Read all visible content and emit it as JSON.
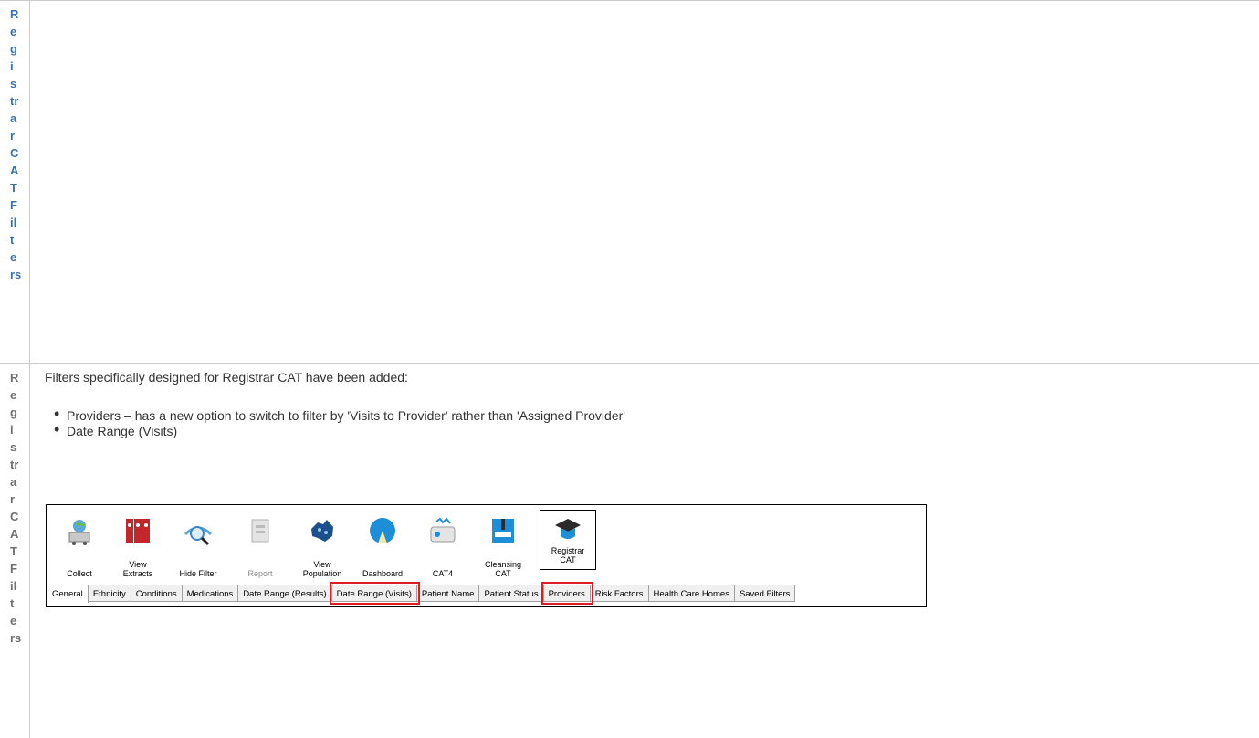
{
  "rows": [
    {
      "label_chars": [
        "R",
        "e",
        "g",
        "i",
        "s",
        "tr",
        "a",
        "r",
        "C",
        "A",
        "T",
        "F",
        "il",
        "t",
        "e",
        "rs"
      ]
    },
    {
      "label_chars": [
        "R",
        "e",
        "g",
        "i",
        "s",
        "tr",
        "a",
        "r",
        "C",
        "A",
        "T",
        "F",
        "il",
        "t",
        "e",
        "rs"
      ]
    }
  ],
  "content": {
    "intro": "Filters specifically designed for Registrar CAT have been added:",
    "bullets": [
      "Providers – has a new option to switch to filter by 'Visits to Provider' rather than 'Assigned Provider'",
      "Date Range (Visits)"
    ]
  },
  "screenshot": {
    "toolbar": [
      {
        "label": "Collect",
        "icon": "collect-icon"
      },
      {
        "label": "View\nExtracts",
        "icon": "extracts-icon"
      },
      {
        "label": "Hide Filter",
        "icon": "hide-filter-icon"
      },
      {
        "label": "Report",
        "icon": "report-icon",
        "disabled": true
      },
      {
        "label": "View\nPopulation",
        "icon": "population-map-icon"
      },
      {
        "label": "Dashboard",
        "icon": "dashboard-icon"
      },
      {
        "label": "CAT4",
        "icon": "cat4-icon"
      },
      {
        "label": "Cleansing\nCAT",
        "icon": "cleansing-cat-icon"
      },
      {
        "label": "Registrar\nCAT",
        "icon": "registrar-cat-icon",
        "boxed": true
      }
    ],
    "tabs": [
      {
        "label": "General",
        "active": true
      },
      {
        "label": "Ethnicity"
      },
      {
        "label": "Conditions"
      },
      {
        "label": "Medications"
      },
      {
        "label": "Date Range (Results)"
      },
      {
        "label": "Date Range (Visits)",
        "highlighted": true
      },
      {
        "label": "Patient Name"
      },
      {
        "label": "Patient Status"
      },
      {
        "label": "Providers",
        "highlighted": true
      },
      {
        "label": "Risk Factors"
      },
      {
        "label": "Health Care Homes"
      },
      {
        "label": "Saved Filters"
      }
    ],
    "highlight_color": "#e01b24"
  },
  "colors": {
    "label_link": "#3b73af",
    "label_muted": "#707070",
    "border": "#cccccc"
  }
}
